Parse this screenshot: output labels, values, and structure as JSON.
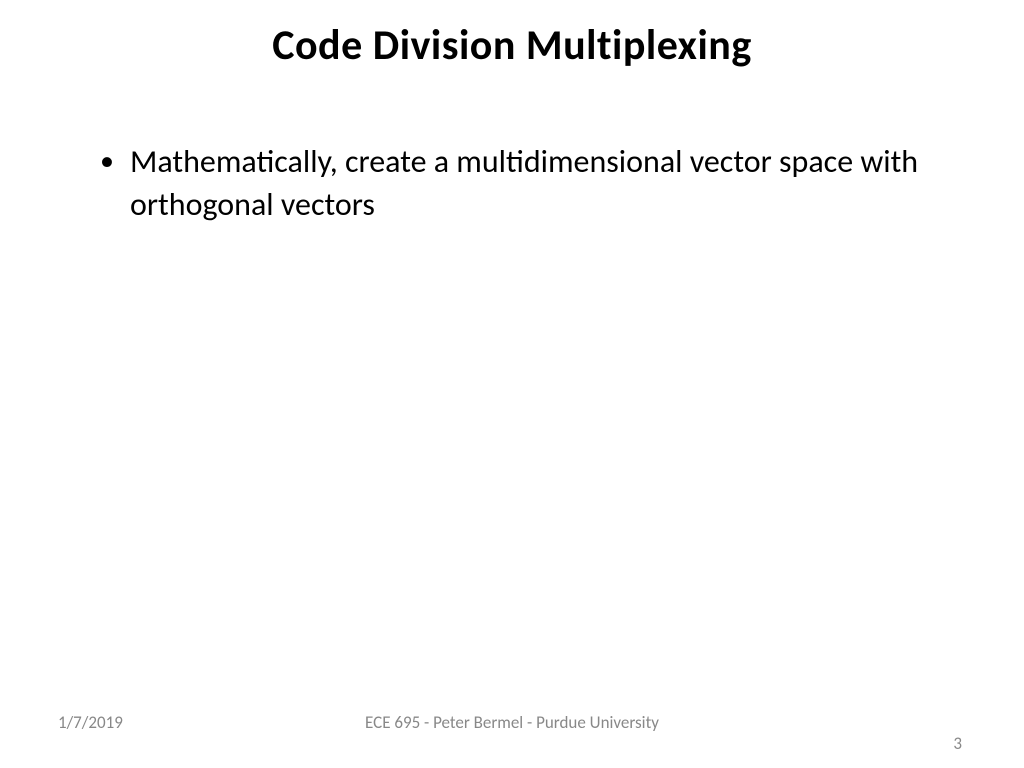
{
  "slide": {
    "title": "Code Division Multiplexing",
    "bullets": [
      {
        "text": "Mathematically, create a multidimensional vector space with orthogonal vectors"
      }
    ],
    "footer": {
      "date": "1/7/2019",
      "center": "ECE 695 - Peter Bermel - Purdue University",
      "page": "3"
    }
  }
}
